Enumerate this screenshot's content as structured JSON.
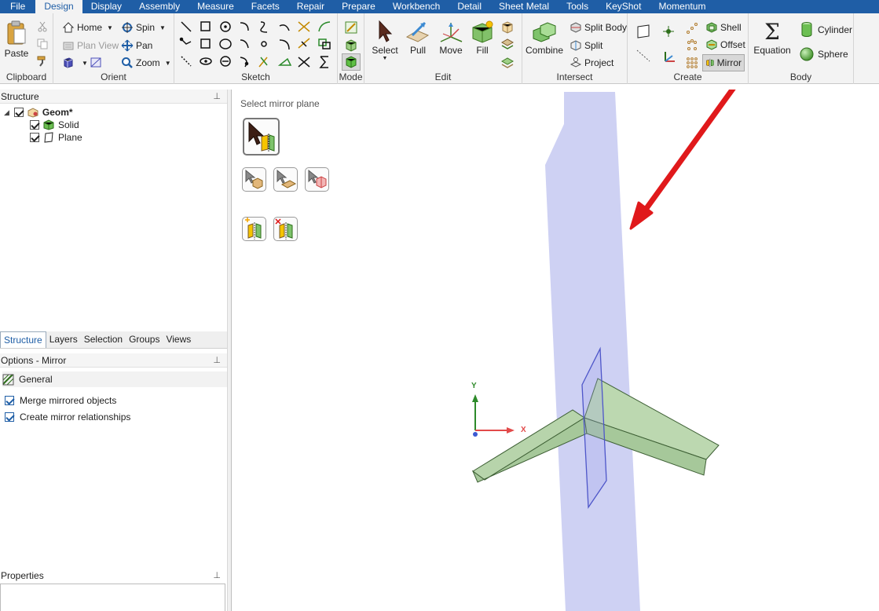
{
  "menu": {
    "tabs": [
      "File",
      "Design",
      "Display",
      "Assembly",
      "Measure",
      "Facets",
      "Repair",
      "Prepare",
      "Workbench",
      "Detail",
      "Sheet Metal",
      "Tools",
      "KeyShot",
      "Momentum"
    ],
    "active": "Design"
  },
  "ribbon": {
    "clipboard": {
      "label": "Clipboard",
      "paste": "Paste"
    },
    "orient": {
      "label": "Orient",
      "home": "Home",
      "spin": "Spin",
      "plan_view": "Plan View",
      "pan": "Pan",
      "zoom": "Zoom"
    },
    "sketch": {
      "label": "Sketch"
    },
    "mode": {
      "label": "Mode"
    },
    "edit": {
      "label": "Edit",
      "select": "Select",
      "pull": "Pull",
      "move": "Move",
      "fill": "Fill"
    },
    "intersect": {
      "label": "Intersect",
      "combine": "Combine",
      "split_body": "Split Body",
      "split": "Split",
      "project": "Project"
    },
    "create": {
      "label": "Create",
      "shell": "Shell",
      "offset": "Offset",
      "mirror": "Mirror"
    },
    "body": {
      "label": "Body",
      "equation": "Equation",
      "cylinder": "Cylinder",
      "sphere": "Sphere"
    }
  },
  "structure": {
    "title": "Structure",
    "root": "Geom*",
    "children": [
      "Solid",
      "Plane"
    ]
  },
  "bottom_tabs": [
    "Structure",
    "Layers",
    "Selection",
    "Groups",
    "Views"
  ],
  "options": {
    "title": "Options - Mirror",
    "section": "General",
    "merge": "Merge mirrored objects",
    "relationships": "Create mirror relationships"
  },
  "properties": {
    "title": "Properties"
  },
  "viewport": {
    "prompt": "Select mirror plane",
    "axis_y": "Y",
    "axis_x": "X"
  },
  "colors": {
    "accent": "#1f5ea6",
    "plane": "#c9ccf2",
    "solid": "#b5d3a9",
    "arrow": "#e0191b"
  }
}
